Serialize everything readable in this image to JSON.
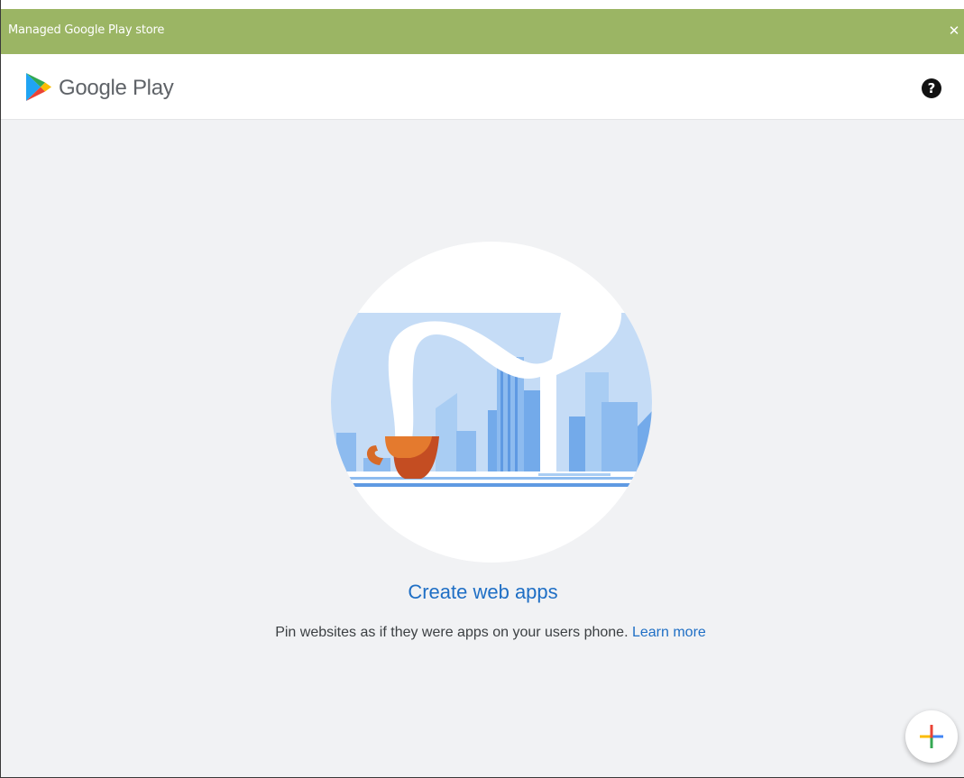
{
  "window": {
    "title": "Managed Google Play store",
    "close_icon": "close-icon",
    "title_bar_color": "#9bb564"
  },
  "header": {
    "brand_name": "Google Play",
    "logo_icon": "google-play-logo-icon",
    "help_icon": "help-icon"
  },
  "empty_state": {
    "illustration": "web-apps-illustration",
    "title": "Create web apps",
    "description": "Pin websites as if they were apps on your users phone.",
    "link_label": "Learn more",
    "link_color": "#1f6fc5"
  },
  "fab": {
    "icon": "add-icon",
    "colors": [
      "#ea4335",
      "#4285f4",
      "#fbbc04",
      "#34a853"
    ]
  }
}
